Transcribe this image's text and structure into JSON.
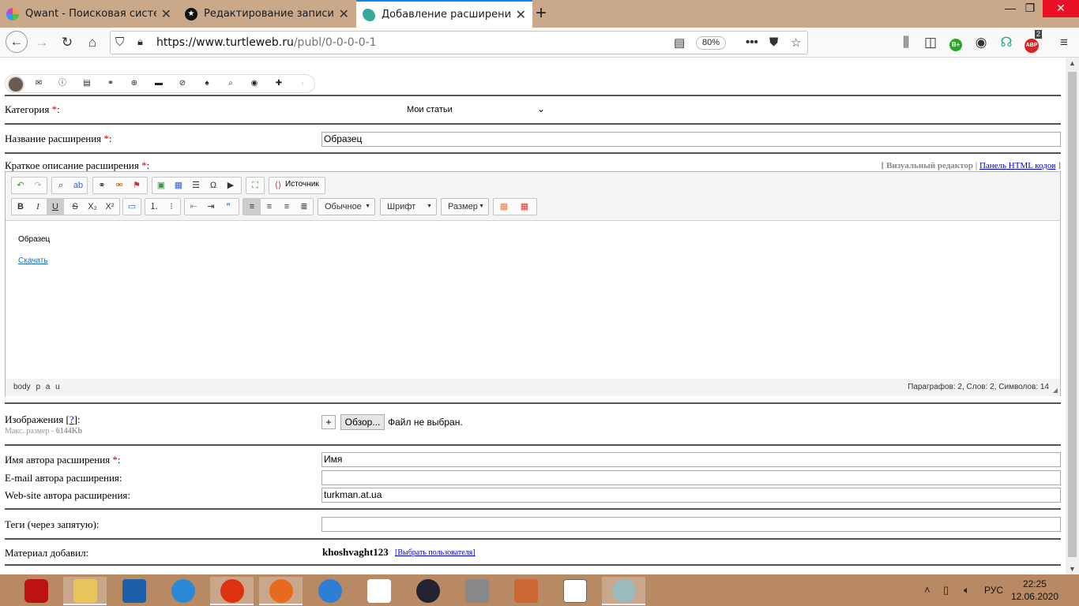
{
  "browser": {
    "tabs": [
      {
        "title": "Qwant - Поисковая система, к",
        "favicon": "qwant-icon",
        "selected": false
      },
      {
        "title": "Редактирование записи",
        "favicon": "star-icon",
        "selected": false
      },
      {
        "title": "Добавление расширения - Ка",
        "favicon": "turtle-icon",
        "selected": true
      }
    ],
    "new_tab_glyph": "+",
    "url_host": "https://www.turtleweb.ru",
    "url_path": "/publ/0-0-0-0-1",
    "zoom": "80%",
    "ext_badge": "2",
    "ext_label": "ABP",
    "ext_green": "B+"
  },
  "user_toolbar": {
    "icons": [
      "avatar",
      "mail-icon",
      "info-icon",
      "news-icon",
      "link-icon",
      "add-icon",
      "folder-icon",
      "ban-icon",
      "bell-icon",
      "search-icon",
      "eye-icon",
      "puzzle-icon",
      "collapse-icon"
    ]
  },
  "form": {
    "category_label": "Категория ",
    "category_value": "Мои статьи",
    "name_label": "Название расширения ",
    "name_value": "Образец",
    "desc_label": "Краткое описание расширения ",
    "req_mark": "*",
    "colon": ":",
    "editor_visual": "[ Визуальный редактор |",
    "editor_html": "Панель HTML кодов",
    "editor_close": "]",
    "toolbar": {
      "source": "Источник",
      "style": "Обычное",
      "font": "Шрифт",
      "size": "Размер"
    },
    "content_p": "Образец",
    "content_link": "Скачать",
    "status_path": "body p a u",
    "status_counts": "Параграфов: 2, Слов: 2, Символов: 14",
    "images_label": "Изображения [",
    "images_help": "?",
    "images_label_end": "]:",
    "images_max": "Макс. размер - ",
    "images_max_val": "6144Kb",
    "browse_plus": "+",
    "browse_button": "Обзор...",
    "no_file": "Файл не выбран.",
    "author_label": "Имя автора расширения ",
    "author_value": "Имя",
    "email_label": "E-mail автора расширения:",
    "email_value": "",
    "website_label": "Web-site автора расширения:",
    "website_value": "turkman.at.ua",
    "tags_label": "Теги (через запятую):",
    "tags_value": "",
    "added_label": "Материал добавил:",
    "added_user": "khoshvaght123",
    "pick_user": "[Выбрать пользователя]"
  },
  "taskbar": {
    "apps": [
      "power-icon",
      "explorer-icon",
      "calc-icon",
      "ie-icon",
      "opera-icon",
      "firefox-icon",
      "swift-icon",
      "office-icon",
      "media-player-icon",
      "firewall-icon",
      "ccleaner-icon",
      "abc-net-icon",
      "disk-icon"
    ],
    "lang": "РУС",
    "time": "22:25",
    "date": "12.06.2020"
  },
  "colors": {
    "tabbar": "#c9a98a",
    "taskbar": "#b78a63",
    "accent": "#0a84ff",
    "required": "#cc0000"
  }
}
